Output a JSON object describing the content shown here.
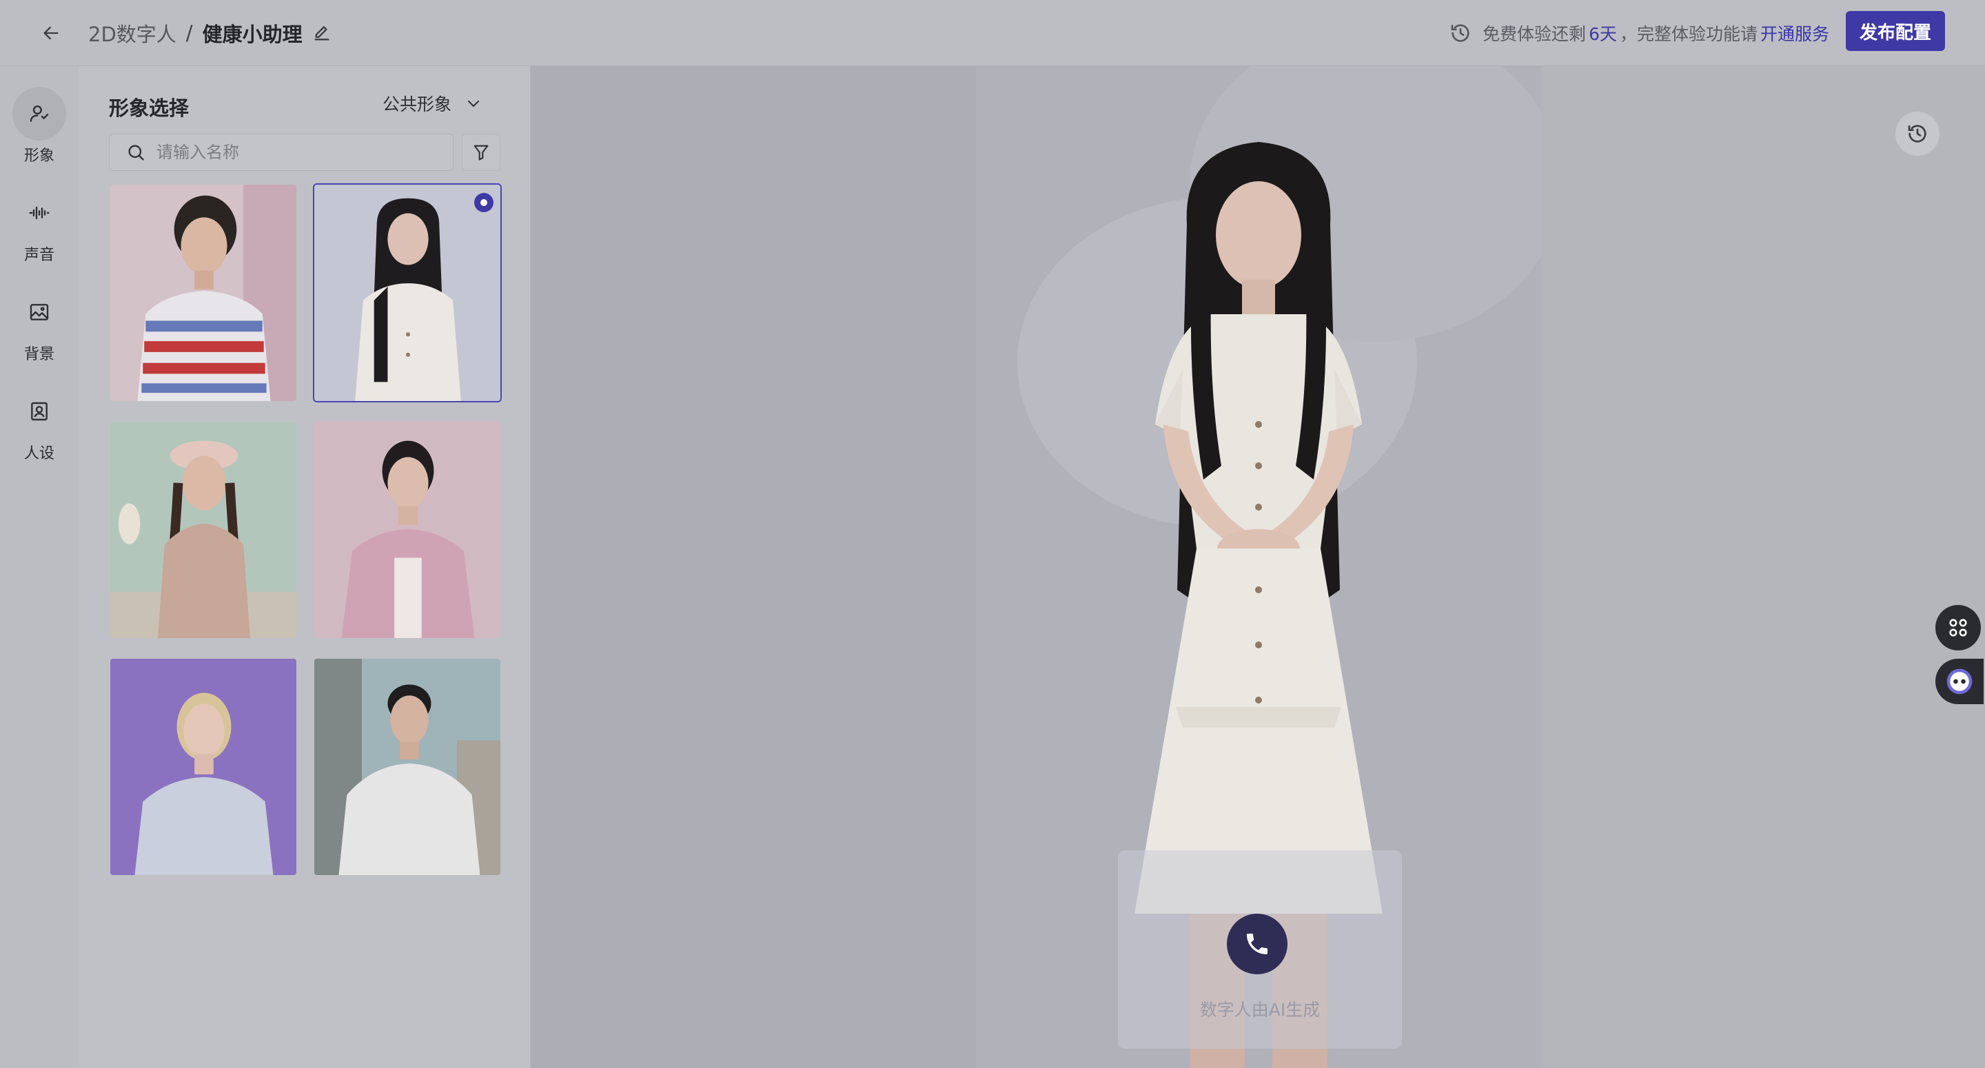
{
  "header": {
    "breadcrumb_parent": "2D数字人",
    "separator": "/",
    "breadcrumb_current": "健康小助理",
    "trial_prefix": "免费体验还剩",
    "trial_days": "6天",
    "trial_suffix": "，完整体验功能请",
    "trial_link": "开通服务",
    "publish_label": "发布配置"
  },
  "rail": {
    "items": [
      {
        "label": "形象",
        "icon": "person-icon",
        "active": true
      },
      {
        "label": "声音",
        "icon": "waveform-icon",
        "active": false
      },
      {
        "label": "背景",
        "icon": "image-icon",
        "active": false
      },
      {
        "label": "人设",
        "icon": "persona-icon",
        "active": false
      }
    ]
  },
  "panel": {
    "title": "形象选择",
    "type_select": "公共形象",
    "search_placeholder": "请输入名称",
    "avatars": [
      {
        "id": 1,
        "selected": false
      },
      {
        "id": 2,
        "selected": true
      },
      {
        "id": 3,
        "selected": false
      },
      {
        "id": 4,
        "selected": false
      },
      {
        "id": 5,
        "selected": false
      },
      {
        "id": 6,
        "selected": false
      }
    ]
  },
  "stage": {
    "ai_note": "数字人由AI生成"
  },
  "colors": {
    "accent": "#3f39a6",
    "call_button": "#2f2c55"
  }
}
